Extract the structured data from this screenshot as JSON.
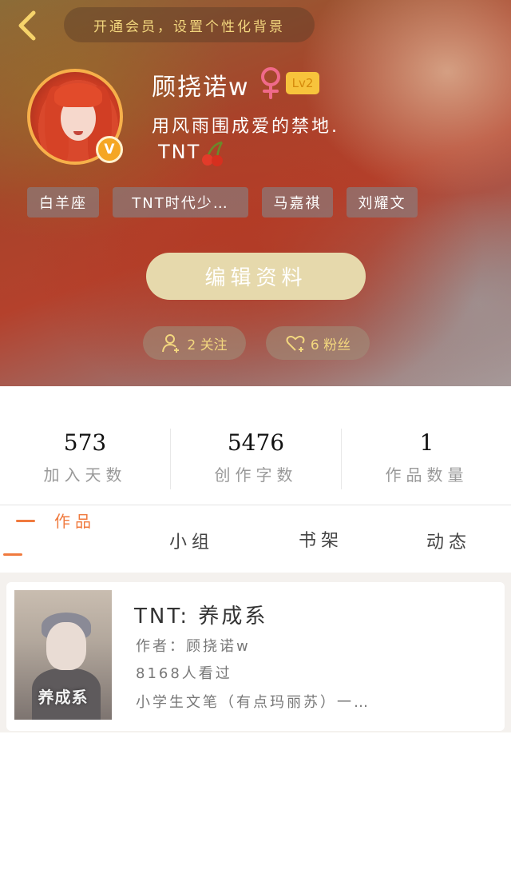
{
  "header": {
    "vip_banner": "开通会员，设置个性化背景",
    "username": "顾挠诺w",
    "level": "Lv2",
    "bio_line1": "用风雨围成爱的禁地.",
    "bio_line2": "TNT",
    "tags": [
      "白羊座",
      "TNT时代少…",
      "马嘉祺",
      "刘耀文"
    ],
    "edit_profile_label": "编辑资料",
    "following_label": "2 关注",
    "followers_label": "6 粉丝",
    "accent_color": "#f3d77e",
    "badge_color": "#f5a623"
  },
  "stats": [
    {
      "value": "573",
      "label": "加入天数"
    },
    {
      "value": "5476",
      "label": "创作字数"
    },
    {
      "value": "1",
      "label": "作品数量"
    }
  ],
  "tabs": [
    "作品",
    "小组",
    "书架",
    "动态"
  ],
  "active_tab_color": "#f07a3e",
  "works": [
    {
      "cover_text": "养成系",
      "title": "TNT: 养成系",
      "author": "作者：顾挠诺w",
      "views": "8168人看过",
      "summary": "小学生文笔（有点玛丽苏）一…"
    }
  ]
}
